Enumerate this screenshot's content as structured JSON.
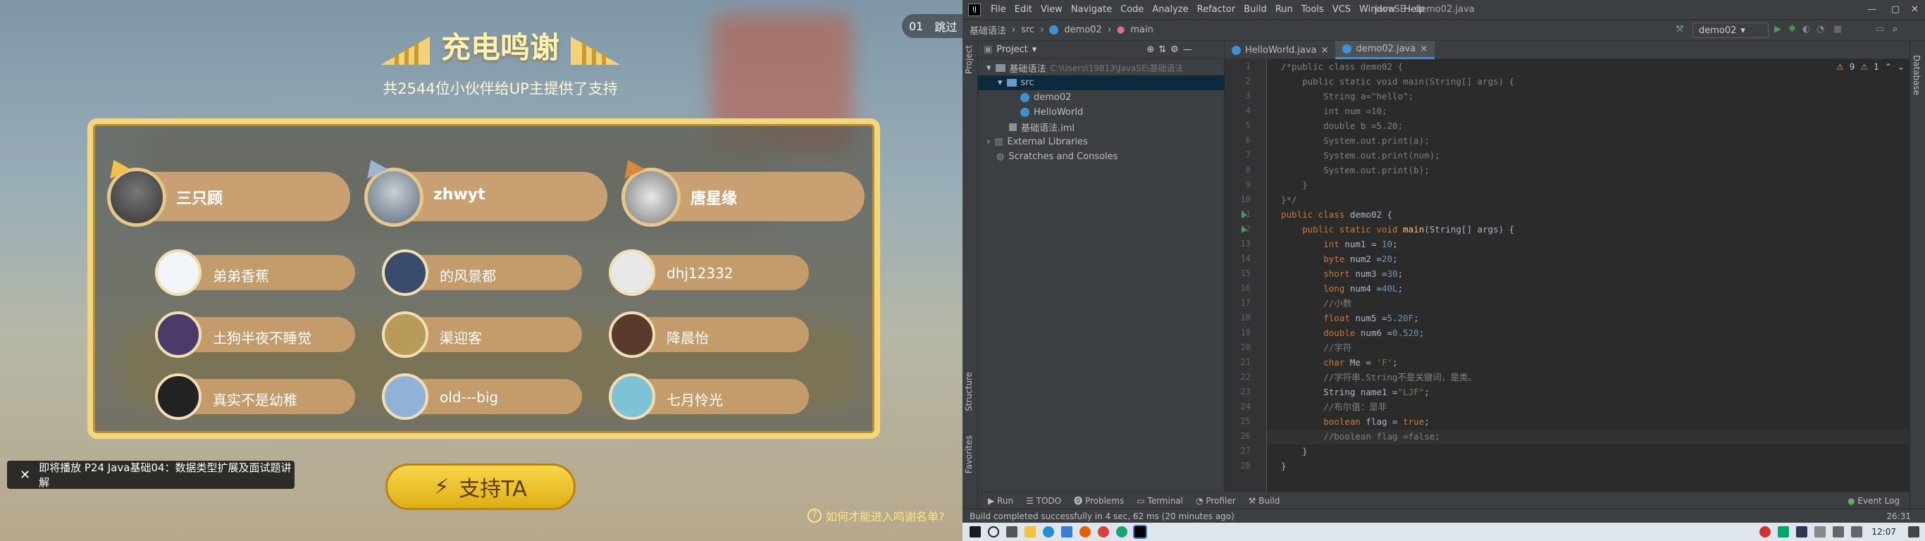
{
  "video": {
    "title": "充电鸣谢",
    "subtitle": "共2544位小伙伴给UP主提供了支持",
    "top_supporters": [
      "三只顾",
      "zhwyt",
      "唐星缘"
    ],
    "supporters": [
      "弟弟香蕉",
      "的风景都",
      "dhj12332",
      "土狗半夜不睡觉",
      "渠迎客",
      "降晨怡",
      "真实不是幼稚",
      "old---big",
      "七月怜光"
    ],
    "support_button": "支持TA",
    "skip_count": "01",
    "skip_label": "跳过",
    "next_video_toast": "即将播放 P24 Java基础04：数据类型扩展及面试题讲解",
    "howto_link": "如何才能进入鸣谢名单?",
    "colors": {
      "gold": "#f6d67a",
      "pill": "#c49c6c",
      "button": "#f2c331"
    }
  },
  "ide": {
    "app_icon": "intellij-icon",
    "menu": [
      "File",
      "Edit",
      "View",
      "Navigate",
      "Code",
      "Analyze",
      "Refactor",
      "Build",
      "Run",
      "Tools",
      "VCS",
      "Window",
      "Help"
    ],
    "window_title": "JavaSE - demo02.java",
    "breadcrumb": [
      "基础语法",
      "src",
      "demo02",
      "main"
    ],
    "run_config": "demo02",
    "project_label": "Project",
    "tree": {
      "root": "基础语法",
      "root_path": "C:\\Users\\19813\\JavaSE\\基础语法",
      "src": "src",
      "files": [
        "demo02",
        "HelloWorld"
      ],
      "iml": "基础语法.iml",
      "external_libraries": "External Libraries",
      "scratches": "Scratches and Consoles"
    },
    "tabs": [
      "HelloWorld.java",
      "demo02.java"
    ],
    "inspections": {
      "warnings": "9",
      "weak": "1"
    },
    "code_lines": [
      "/*public class demo02 {",
      "    public static void main(String[] args) {",
      "        String a=\"hello\";",
      "        int num =10;",
      "        double b =5.20;",
      "        System.out.print(a);",
      "        System.out.print(num);",
      "        System.out.print(b);",
      "    }",
      "}*/",
      "public class demo02 {",
      "    public static void main(String[] args) {",
      "        int num1 = 10;",
      "        byte num2 =20;",
      "        short num3 =30;",
      "        long num4 =40L;",
      "        //小数",
      "        float num5 =5.20F;",
      "        double num6 =0.520;",
      "        //字符",
      "        char Me = 'F';",
      "        //字符串,String不是关键词，是类。",
      "        String name1 =\"LJF\";",
      "        //布尔值：是非",
      "        boolean flag = true;",
      "        //boolean flag =false;",
      "    }",
      "}"
    ],
    "left_tools": [
      "Project",
      "Structure",
      "Favorites"
    ],
    "right_tools": [
      "Database"
    ],
    "bottom_tools": [
      "Run",
      "TODO",
      "Problems",
      "Terminal",
      "Profiler",
      "Build"
    ],
    "event_log": "Event Log",
    "status_message": "Build completed successfully in 4 sec, 62 ms (20 minutes ago)",
    "cursor_pos": "26:31",
    "clock": "12:07"
  }
}
